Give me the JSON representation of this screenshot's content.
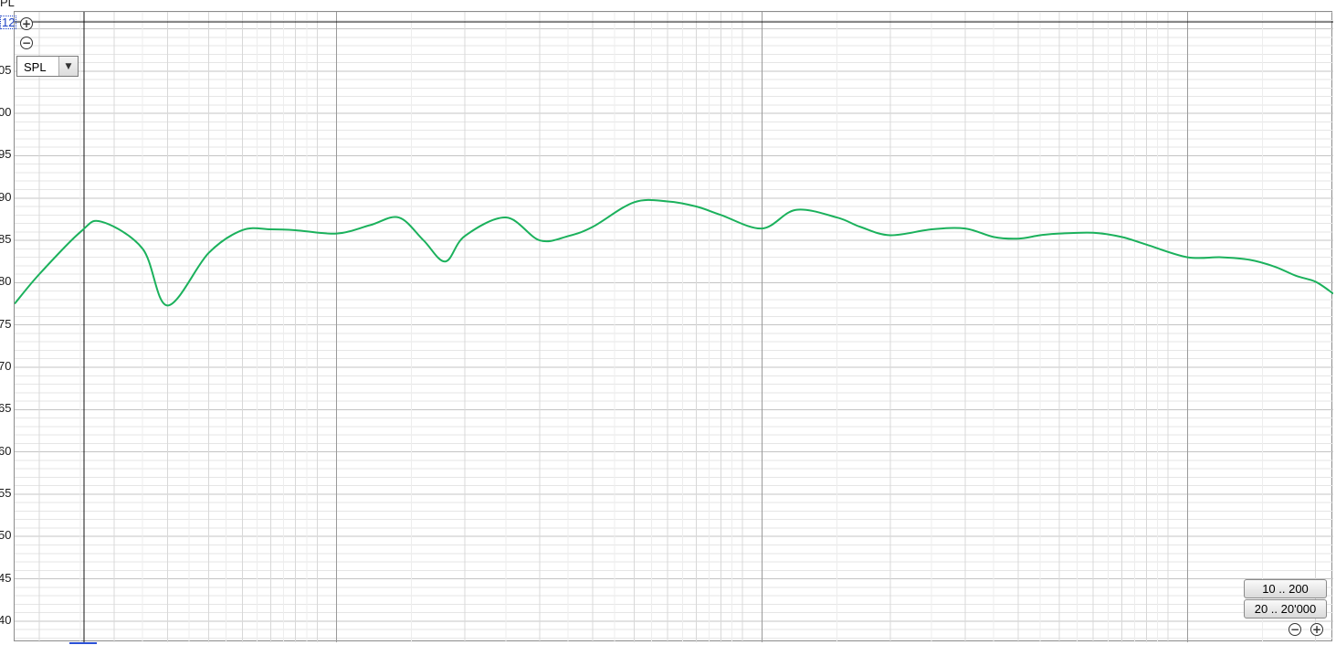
{
  "axis": {
    "y_unit_fragment": "PL",
    "top_value_fragment": "12",
    "y_tick_labels": [
      "05",
      "00",
      "95",
      "90",
      "85",
      "80",
      "75",
      "70",
      "65",
      "60",
      "55",
      "50",
      "45",
      "40"
    ]
  },
  "controls": {
    "zoom_in_icon": "plus-circle-icon",
    "zoom_out_icon": "minus-circle-icon",
    "measurement_select": "SPL",
    "range_buttons": [
      "10 .. 200",
      "20 .. 20'000"
    ]
  },
  "colors": {
    "trace": "#1bb15c",
    "grid_minor": "#e6e6e6",
    "grid_major": "#9a9a9a"
  },
  "chart_data": {
    "type": "line",
    "title": "",
    "xlabel": "",
    "ylabel": "SPL",
    "x_scale": "log",
    "xlim": [
      17.5,
      22000
    ],
    "ylim": [
      37.5,
      112
    ],
    "grid": true,
    "series": [
      {
        "values_x": [
          17.5,
          20,
          25,
          28,
          35,
          40,
          50,
          60,
          70,
          80,
          100,
          120,
          140,
          160,
          180,
          200,
          250,
          300,
          350,
          400,
          500,
          600,
          700,
          800,
          1000,
          1200,
          1500,
          1700,
          2000,
          2500,
          3000,
          3500,
          4000,
          4500,
          5000,
          6000,
          7000,
          8000,
          10000,
          12000,
          14000,
          16000,
          18000,
          20000,
          22000
        ],
        "values_y": [
          77.5,
          81,
          86,
          87.2,
          84,
          77.3,
          83.5,
          86.2,
          86.3,
          86.2,
          85.8,
          86.8,
          87.7,
          85,
          82.5,
          85.5,
          87.7,
          85,
          85.5,
          86.6,
          89.5,
          89.6,
          89,
          88,
          86.4,
          88.6,
          87.7,
          86.6,
          85.6,
          86.3,
          86.4,
          85.4,
          85.2,
          85.6,
          85.8,
          85.9,
          85.4,
          84.5,
          83,
          83,
          82.7,
          81.9,
          80.8,
          80.1,
          78.7
        ]
      }
    ]
  }
}
